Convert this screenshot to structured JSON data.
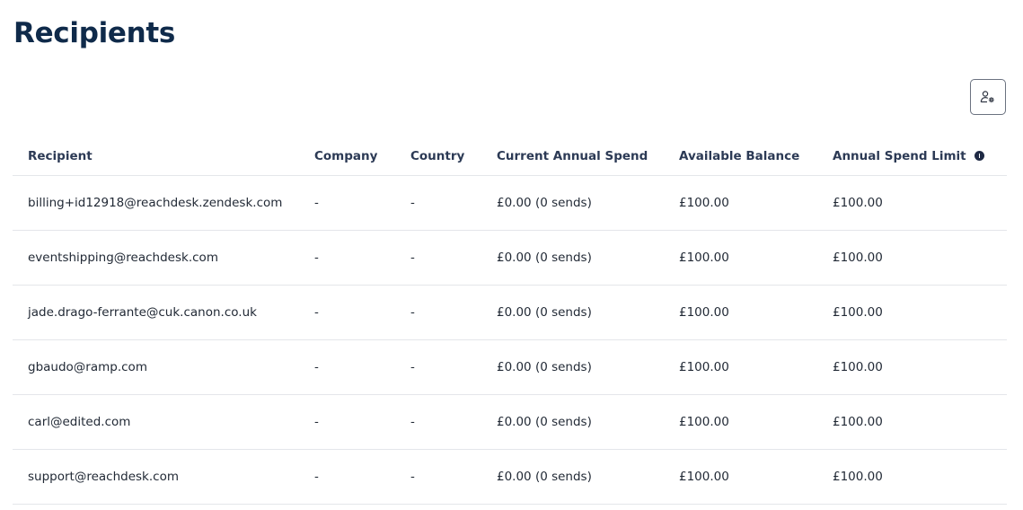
{
  "header": {
    "title": "Recipients",
    "settings_icon": "user-settings-icon"
  },
  "table": {
    "columns": [
      "Recipient",
      "Company",
      "Country",
      "Current Annual Spend",
      "Available Balance",
      "Annual Spend Limit"
    ],
    "info_icon": "info-icon",
    "rows": [
      [
        "billing+id12918@reachdesk.zendesk.com",
        "-",
        "-",
        "£0.00 (0 sends)",
        "£100.00",
        "£100.00"
      ],
      [
        "eventshipping@reachdesk.com",
        "-",
        "-",
        "£0.00 (0 sends)",
        "£100.00",
        "£100.00"
      ],
      [
        "jade.drago-ferrante@cuk.canon.co.uk",
        "-",
        "-",
        "£0.00 (0 sends)",
        "£100.00",
        "£100.00"
      ],
      [
        "gbaudo@ramp.com",
        "-",
        "-",
        "£0.00 (0 sends)",
        "£100.00",
        "£100.00"
      ],
      [
        "carl@edited.com",
        "-",
        "-",
        "£0.00 (0 sends)",
        "£100.00",
        "£100.00"
      ],
      [
        "support@reachdesk.com",
        "-",
        "-",
        "£0.00 (0 sends)",
        "£100.00",
        "£100.00"
      ]
    ]
  },
  "colors": {
    "title": "#0f2a4a",
    "header_text": "#2c3a55",
    "divider": "#e4e6ea",
    "button_border": "#6b7280"
  }
}
